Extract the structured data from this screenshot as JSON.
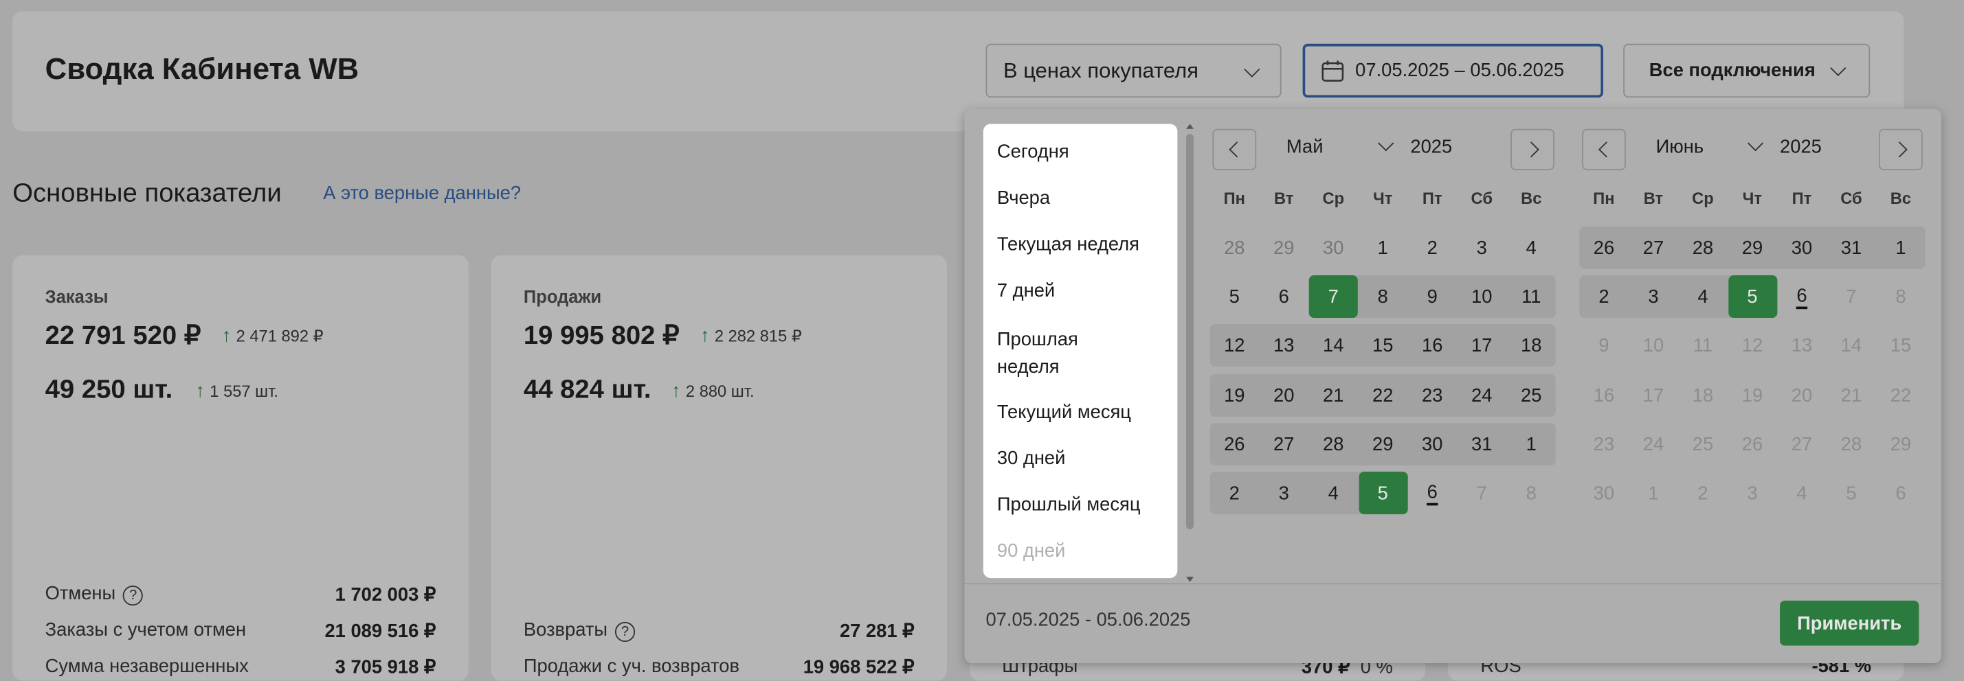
{
  "header": {
    "title": "Сводка Кабинета WB",
    "price_mode": "В ценах покупателя",
    "date_range": "07.05.2025 – 05.06.2025",
    "connections": "Все подключения"
  },
  "section": {
    "title": "Основные показатели",
    "link": "А это верные данные?"
  },
  "cards": [
    {
      "label": "Заказы",
      "amount": "22 791 520 ₽",
      "amount_delta": "2 471 892 ₽",
      "qty": "49 250 шт.",
      "qty_delta": "1 557 шт.",
      "rows": [
        {
          "label": "Отмены",
          "value": "1 702 003 ₽"
        },
        {
          "label": "Заказы с учетом отмен",
          "value": "21 089 516 ₽"
        },
        {
          "label": "Сумма незавершенных",
          "value": "3 705 918 ₽"
        }
      ]
    },
    {
      "label": "Продажи",
      "amount": "19 995 802 ₽",
      "amount_delta": "2 282 815 ₽",
      "qty": "44 824 шт.",
      "qty_delta": "2 880 шт.",
      "rows": [
        {
          "label": "Возвраты",
          "value": "27 281 ₽"
        },
        {
          "label": "Продажи с уч. возвратов",
          "value": "19 968 522 ₽"
        }
      ]
    }
  ],
  "behind": {
    "fines_label": "Штрафы",
    "fines_value": "370 ₽",
    "fines_pct": "0 %",
    "ros_label": "ROS",
    "ros_value": "-581 %"
  },
  "datepicker": {
    "presets": [
      "Сегодня",
      "Вчера",
      "Текущая неделя",
      "7 дней",
      "Прошлая\nнеделя",
      "Текущий месяц",
      "30 дней",
      "Прошлый месяц",
      "90 дней"
    ],
    "weekdays": [
      "Пн",
      "Вт",
      "Ср",
      "Чт",
      "Пт",
      "Сб",
      "Вс"
    ],
    "left": {
      "month": "Май",
      "year": "2025",
      "weeks": [
        [
          "28",
          "29",
          "30",
          "1",
          "2",
          "3",
          "4"
        ],
        [
          "5",
          "6",
          "7",
          "8",
          "9",
          "10",
          "11"
        ],
        [
          "12",
          "13",
          "14",
          "15",
          "16",
          "17",
          "18"
        ],
        [
          "19",
          "20",
          "21",
          "22",
          "23",
          "24",
          "25"
        ],
        [
          "26",
          "27",
          "28",
          "29",
          "30",
          "31",
          "1"
        ],
        [
          "2",
          "3",
          "4",
          "5",
          "6",
          "7",
          "8"
        ]
      ]
    },
    "right": {
      "month": "Июнь",
      "year": "2025",
      "weeks": [
        [
          "26",
          "27",
          "28",
          "29",
          "30",
          "31",
          "1"
        ],
        [
          "2",
          "3",
          "4",
          "5",
          "6",
          "7",
          "8"
        ],
        [
          "9",
          "10",
          "11",
          "12",
          "13",
          "14",
          "15"
        ],
        [
          "16",
          "17",
          "18",
          "19",
          "20",
          "21",
          "22"
        ],
        [
          "23",
          "24",
          "25",
          "26",
          "27",
          "28",
          "29"
        ],
        [
          "30",
          "1",
          "2",
          "3",
          "4",
          "5",
          "6"
        ]
      ]
    },
    "range_text": "07.05.2025 - 05.06.2025",
    "apply": "Применить"
  },
  "colors": {
    "accent": "#2c7b3e",
    "link": "#264c80",
    "focus": "#2a4d86"
  }
}
